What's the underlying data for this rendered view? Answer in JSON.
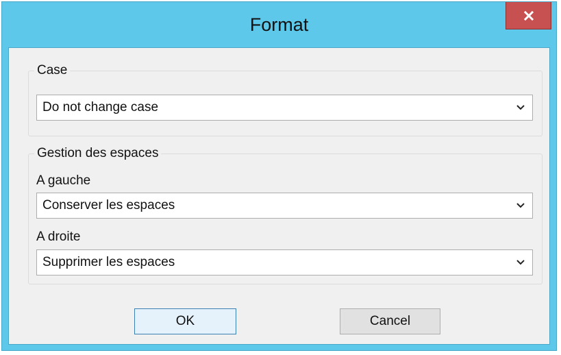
{
  "window": {
    "title": "Format",
    "close_label": "x"
  },
  "case_group": {
    "label": "Case",
    "select_value": "Do not change case"
  },
  "spaces_group": {
    "label": "Gestion des espaces",
    "left": {
      "label": "A gauche",
      "select_value": "Conserver les espaces"
    },
    "right": {
      "label": "A droite",
      "select_value": "Supprimer les espaces"
    }
  },
  "buttons": {
    "ok_label": "OK",
    "cancel_label": "Cancel"
  },
  "colors": {
    "titlebar": "#5ec8ea",
    "close_button": "#c75050",
    "client_background": "#f0f0f0",
    "default_button_border": "#3c7fb1"
  },
  "icons": {
    "close": "close-icon",
    "dropdown": "chevron-down-icon"
  }
}
